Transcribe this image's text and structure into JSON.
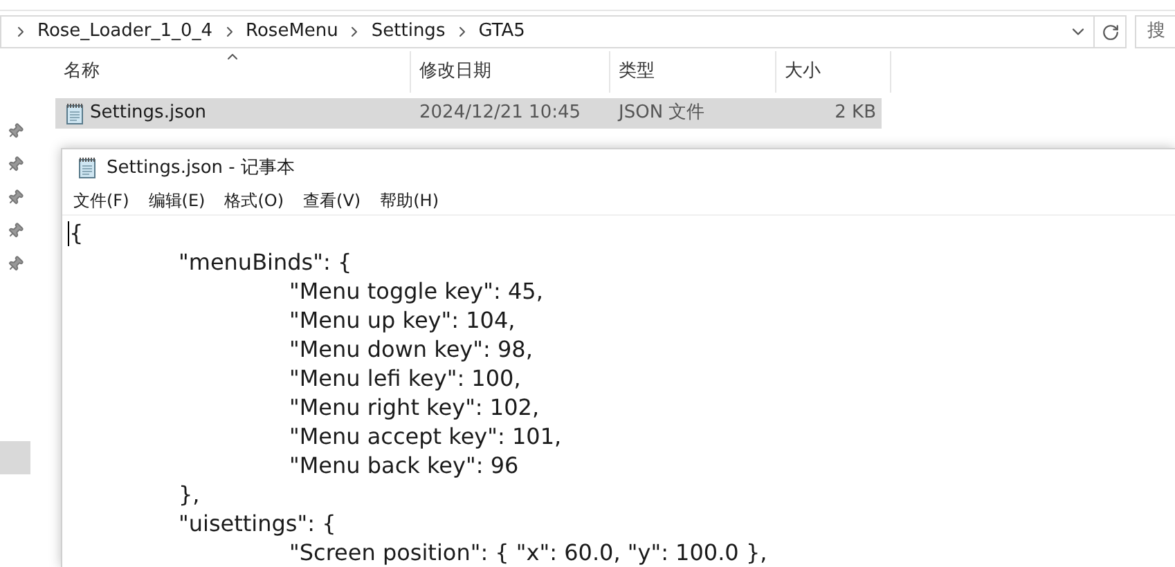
{
  "address_bar": {
    "path": [
      {
        "label": "Rose_Loader_1_0_4"
      },
      {
        "label": "RoseMenu"
      },
      {
        "label": "Settings"
      },
      {
        "label": "GTA5"
      }
    ],
    "search_placeholder": "搜"
  },
  "file_list": {
    "columns": [
      {
        "label": "名称",
        "sorted": true
      },
      {
        "label": "修改日期",
        "sorted": false
      },
      {
        "label": "类型",
        "sorted": false
      },
      {
        "label": "大小",
        "sorted": false
      }
    ],
    "rows": [
      {
        "name": "Settings.json",
        "modified": "2024/12/21 10:45",
        "type": "JSON 文件",
        "size": "2 KB",
        "selected": true
      }
    ]
  },
  "sidebar": {
    "items": [
      {
        "selected": true
      }
    ]
  },
  "notepad": {
    "title": "Settings.json - 记事本",
    "menu": [
      "文件(F)",
      "编辑(E)",
      "格式(O)",
      "查看(V)",
      "帮助(H)"
    ],
    "lines": [
      {
        "text": "{",
        "children": [
          {
            "text": "\"menuBinds\": {",
            "children": [
              {
                "text": "\"Menu toggle key\": 45,"
              },
              {
                "text": "\"Menu up key\": 104,"
              },
              {
                "text": "\"Menu down key\": 98,"
              },
              {
                "text": "\"Menu lefi key\": 100,"
              },
              {
                "text": "\"Menu right key\": 102,"
              },
              {
                "text": "\"Menu accept key\": 101,"
              },
              {
                "text": "\"Menu back key\": 96"
              }
            ]
          },
          {
            "text": "},"
          },
          {
            "text": "\"uisettings\": {",
            "children": [
              {
                "text": "\"Screen position\": { \"x\": 60.0, \"y\": 100.0 },"
              }
            ]
          }
        ]
      }
    ]
  }
}
